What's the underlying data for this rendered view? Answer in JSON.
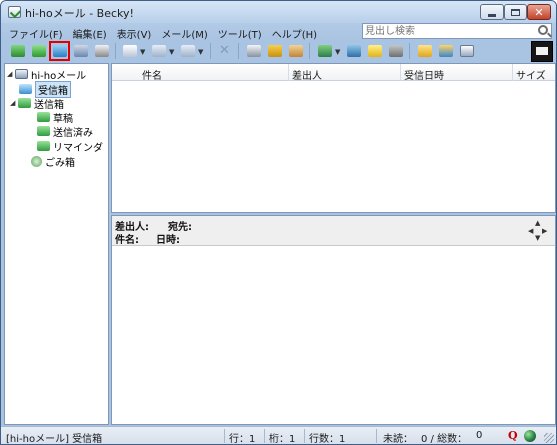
{
  "window": {
    "title": "hi-hoメール - Becky!"
  },
  "menu": [
    "ファイル(F)",
    "編集(E)",
    "表示(V)",
    "メール(M)",
    "ツール(T)",
    "ヘルプ(H)"
  ],
  "search": {
    "placeholder": "見出し検索"
  },
  "toolbar": {
    "icons": [
      "receive-mail-icon",
      "receive-all-icon",
      "check-mail-icon",
      "send-receive-icon",
      "print-icon",
      "new-message-icon",
      "reply-icon",
      "forward-icon",
      "delete-icon",
      "filter-icon",
      "pencil-icon",
      "address-book-icon",
      "move-icon",
      "copy-icon",
      "reminder-icon",
      "archive-icon",
      "folder-icon",
      "settings-icon",
      "window-layout-icon",
      "becky-logo-icon"
    ],
    "selected": "check-mail-icon",
    "selection_color": "#e00000"
  },
  "folders": [
    {
      "label": "hi-hoメール",
      "icon": "mailbox-icon",
      "level": 0,
      "expanded": true
    },
    {
      "label": "受信箱",
      "icon": "inbox-icon",
      "level": 1,
      "selected": true
    },
    {
      "label": "送信箱",
      "icon": "outbox-icon",
      "level": 1,
      "expanded": true
    },
    {
      "label": "草稿",
      "icon": "draft-folder-icon",
      "level": 2
    },
    {
      "label": "送信済み",
      "icon": "sent-folder-icon",
      "level": 2
    },
    {
      "label": "リマインダ",
      "icon": "reminder-folder-icon",
      "level": 2
    },
    {
      "label": "ごみ箱",
      "icon": "trash-icon",
      "level": 1
    }
  ],
  "message_list": {
    "columns": [
      "件名",
      "差出人",
      "受信日時",
      "サイズ"
    ],
    "rows": []
  },
  "preview": {
    "from_label": "差出人:",
    "to_label": "宛先:",
    "subject_label": "件名:",
    "date_label": "日時:"
  },
  "status": {
    "folder": "[hi-hoメール] 受信箱",
    "row": "行：1",
    "column": "桁：1",
    "line_count": "行数：1",
    "unread": "未読：",
    "counts": "0 / 総数：",
    "total": "0"
  }
}
